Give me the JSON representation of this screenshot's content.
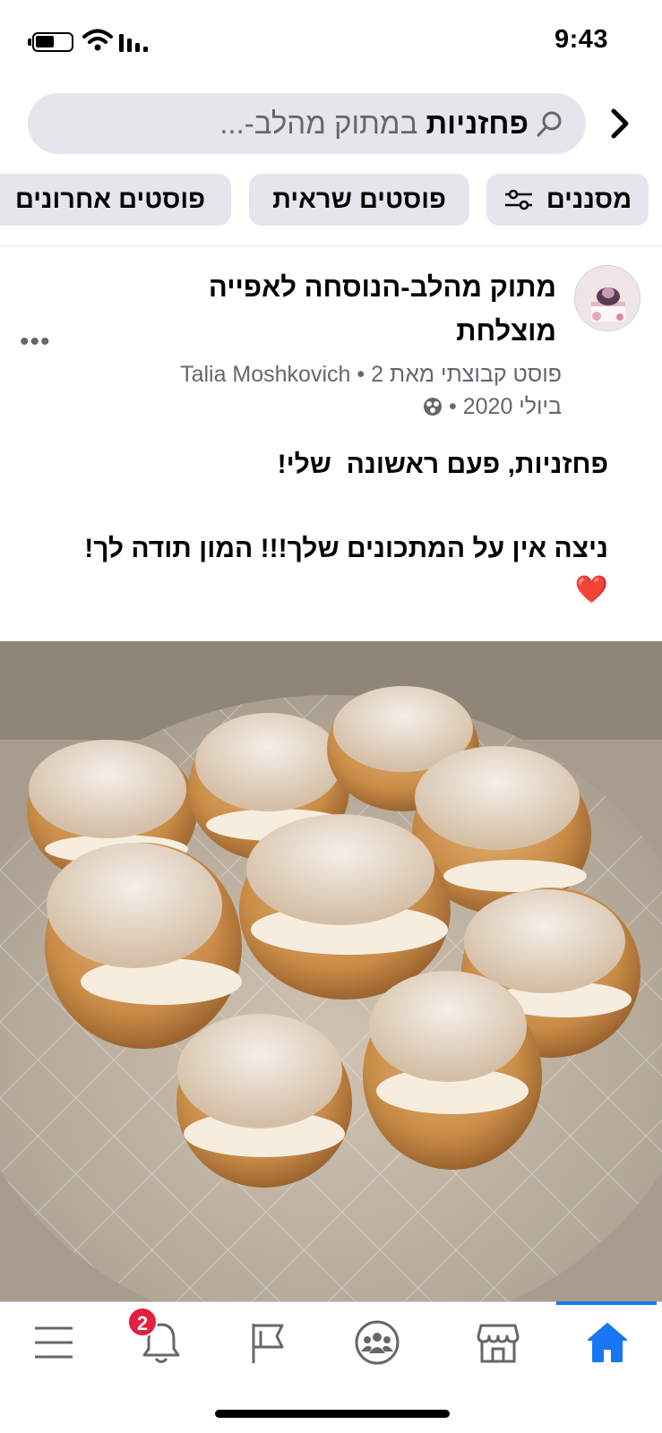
{
  "status_bar": {
    "time": "9:43"
  },
  "search": {
    "query_bold": "פחזניות",
    "query_scope": "במתוק מהלב-..."
  },
  "chips": {
    "filters": "מסננים",
    "photo_posts": "פוסטים שראית",
    "recent_posts": "פוסטים אחרונים"
  },
  "post": {
    "group_name": "מתוק מהלב-הנוסחה לאפייה מוצלחת",
    "meta_line1": "פוסט קבוצתי מאת Talia Moshkovich • 2",
    "meta_line2": "ביולי 2020 •",
    "more": "•••",
    "body_line1": "פחזניות, פעם ראשונה  שלי!",
    "body_line2": "ניצה אין על המתכונים שלך!!! המון תודה לך!",
    "body_emoji": "❤️"
  },
  "tabbar": {
    "notifications_badge": "2",
    "active_tab": "home",
    "tabs": [
      "home",
      "marketplace",
      "groups",
      "pages",
      "notifications",
      "menu"
    ]
  },
  "colors": {
    "accent": "#1877f2",
    "badge": "#e41e3f",
    "chip_bg": "#e4e6eb",
    "secondary_text": "#65676b"
  },
  "icons": [
    "battery-icon",
    "wifi-icon",
    "signal-icon",
    "search-icon",
    "back-chevron-icon",
    "filter-sliders-icon",
    "globe-icon",
    "home-icon",
    "store-icon",
    "groups-icon",
    "flag-icon",
    "bell-icon",
    "hamburger-menu-icon"
  ]
}
